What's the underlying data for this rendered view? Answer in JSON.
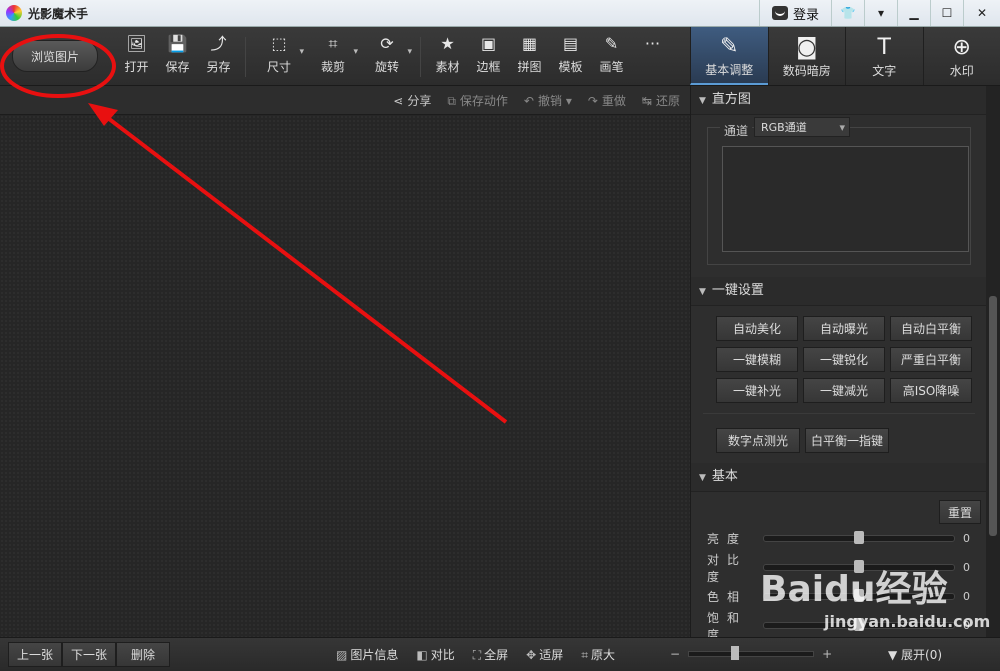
{
  "app": {
    "title": "光影魔术手",
    "login_label": "登录"
  },
  "window_controls": [
    "衣",
    "▾",
    "−",
    "☐",
    "✕"
  ],
  "toolbar": {
    "browse_label": "浏览图片",
    "tools": [
      {
        "label": "打开",
        "icon": "open-icon",
        "glyph": "🖼"
      },
      {
        "label": "保存",
        "icon": "save-icon",
        "glyph": "💾"
      },
      {
        "label": "另存",
        "icon": "save-as-icon",
        "glyph": "⤴"
      },
      {
        "label": "尺寸",
        "icon": "resize-icon",
        "glyph": "⬚"
      },
      {
        "label": "裁剪",
        "icon": "crop-icon",
        "glyph": "⌗"
      },
      {
        "label": "旋转",
        "icon": "rotate-icon",
        "glyph": "⟳"
      },
      {
        "label": "素材",
        "icon": "material-icon",
        "glyph": "★"
      },
      {
        "label": "边框",
        "icon": "border-icon",
        "glyph": "▣"
      },
      {
        "label": "拼图",
        "icon": "collage-icon",
        "glyph": "▦"
      },
      {
        "label": "模板",
        "icon": "template-icon",
        "glyph": "▤"
      },
      {
        "label": "画笔",
        "icon": "brush-icon",
        "glyph": "✎"
      },
      {
        "label": "",
        "icon": "more-icon",
        "glyph": "···"
      }
    ],
    "right_tabs": [
      {
        "label": "基本调整",
        "icon": "adjust-icon",
        "glyph": "✎"
      },
      {
        "label": "数码暗房",
        "icon": "camera-icon",
        "glyph": "◙"
      },
      {
        "label": "文字",
        "icon": "text-icon",
        "glyph": "T"
      },
      {
        "label": "水印",
        "icon": "watermark-icon",
        "glyph": "⊕"
      }
    ]
  },
  "subbar": {
    "share": "分享",
    "save_action": "保存动作",
    "undo": "撤销",
    "redo": "重做",
    "restore": "还原"
  },
  "panel": {
    "histogram": {
      "title": "直方图",
      "channel_label": "通道",
      "channel_value": "RGB通道"
    },
    "oneclick": {
      "title": "一键设置",
      "buttons": [
        "自动美化",
        "自动曝光",
        "自动白平衡",
        "一键模糊",
        "一键锐化",
        "严重白平衡",
        "一键补光",
        "一键减光",
        "高ISO降噪"
      ],
      "extra_buttons": [
        "数字点测光",
        "白平衡一指键"
      ]
    },
    "basic": {
      "title": "基本",
      "reset_label": "重置",
      "sliders": [
        {
          "name": "亮度",
          "value": 0,
          "level": 0.5
        },
        {
          "name": "对比度",
          "value": 0,
          "level": 0.5
        },
        {
          "name": "色相",
          "value": 0,
          "level": 0.5
        },
        {
          "name": "饱和度",
          "value": 0,
          "level": 0.5
        }
      ]
    }
  },
  "status": {
    "prev": "上一张",
    "next": "下一张",
    "delete": "删除",
    "info": "图片信息",
    "compare": "对比",
    "fullscreen": "全屏",
    "fit": "适屏",
    "original": "原大",
    "zoom_level": 0.37,
    "expand": "展开(0)"
  },
  "watermark": {
    "brand": "Baidu经验",
    "url": "jingyan.baidu.com"
  },
  "colors": {
    "annotation": "#e81010",
    "accent_tab": "#3f5c80"
  }
}
